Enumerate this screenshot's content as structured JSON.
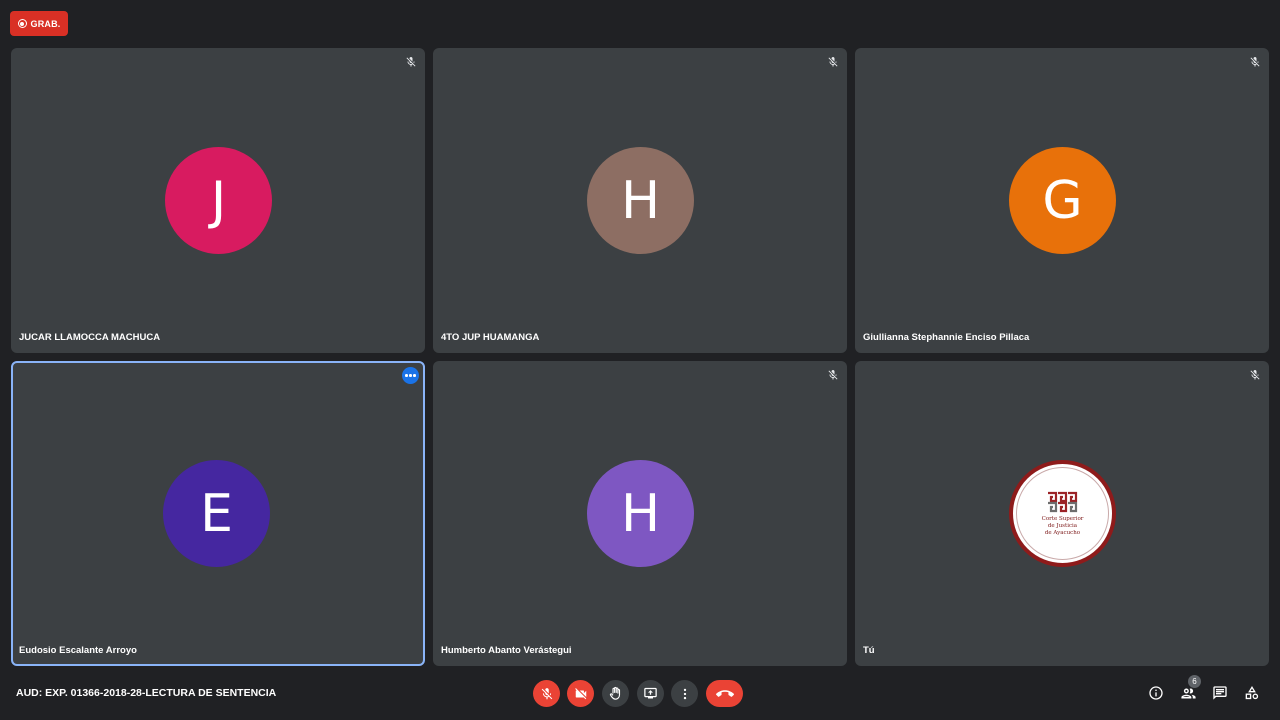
{
  "recording": {
    "label": "GRAB.",
    "color": "#d93025"
  },
  "tiles": [
    {
      "name": "JUCAR LLAMOCCA MACHUCA",
      "initial": "J",
      "avatar_color": "#d81b60",
      "muted": true
    },
    {
      "name": "4TO JUP HUAMANGA",
      "initial": "H",
      "avatar_color": "#8d6e63",
      "muted": true
    },
    {
      "name": "Giullianna Stephannie Enciso Pillaca",
      "initial": "G",
      "avatar_color": "#e8710a",
      "muted": true
    },
    {
      "name": "Eudosio Escalante Arroyo",
      "initial": "E",
      "avatar_color": "#4527a0",
      "muted": false,
      "active": true
    },
    {
      "name": "Humberto Abanto Verástegui",
      "initial": "H",
      "avatar_color": "#7e57c2",
      "muted": true
    },
    {
      "name": "Tú",
      "logo_text": [
        "Corte Superior",
        "de Justicia",
        "de Ayacucho"
      ],
      "muted": true
    }
  ],
  "meeting": {
    "title": "AUD: EXP. 01366-2018-28-LECTURA DE SENTENCIA"
  },
  "controls": {
    "mic": "mic-off-icon",
    "camera": "videocam-off-icon",
    "hand": "raise-hand-icon",
    "present": "present-screen-icon",
    "more": "more-vert-icon",
    "end": "call-end-icon"
  },
  "side_panel": {
    "people_count": "6"
  },
  "colors": {
    "background": "#202124",
    "tile": "#3c4043",
    "active_border": "#8ab4f8",
    "danger": "#ea4335"
  }
}
